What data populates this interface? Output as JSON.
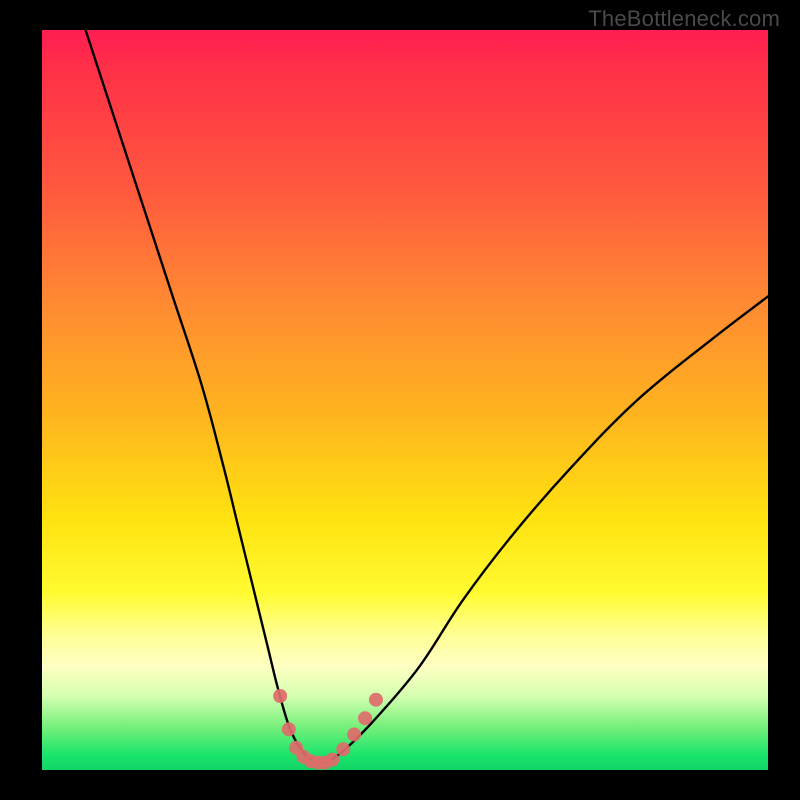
{
  "watermark": "TheBottleneck.com",
  "chart_data": {
    "type": "line",
    "title": "",
    "xlabel": "",
    "ylabel": "",
    "xlim": [
      0,
      100
    ],
    "ylim": [
      0,
      100
    ],
    "series": [
      {
        "name": "bottleneck-curve",
        "x": [
          6,
          10,
          14,
          18,
          22,
          25,
          27,
          29,
          31,
          32.5,
          34,
          35.5,
          37,
          38,
          39,
          40,
          42,
          46,
          52,
          58,
          65,
          73,
          82,
          92,
          100
        ],
        "values": [
          100,
          88,
          76,
          64,
          52,
          41,
          33,
          25,
          17,
          11,
          6,
          3,
          1.5,
          1,
          1,
          1.5,
          3,
          7,
          14,
          23,
          32,
          41,
          50,
          58,
          64
        ]
      }
    ],
    "markers": {
      "name": "highlight-dots",
      "color": "#e06b6b",
      "x": [
        32.8,
        34.0,
        35.0,
        36.0,
        37.0,
        38.0,
        39.0,
        40.0,
        41.5,
        43.0,
        44.5,
        46.0
      ],
      "values": [
        10.0,
        5.5,
        3.0,
        1.8,
        1.2,
        1.0,
        1.0,
        1.4,
        2.8,
        4.8,
        7.0,
        9.5
      ]
    },
    "gradient_stops": [
      {
        "pos": 0.0,
        "color": "#ff1e52"
      },
      {
        "pos": 0.22,
        "color": "#ff5a3e"
      },
      {
        "pos": 0.52,
        "color": "#ffb41f"
      },
      {
        "pos": 0.76,
        "color": "#fffb30"
      },
      {
        "pos": 0.9,
        "color": "#d4ffb0"
      },
      {
        "pos": 1.0,
        "color": "#12d468"
      }
    ]
  }
}
